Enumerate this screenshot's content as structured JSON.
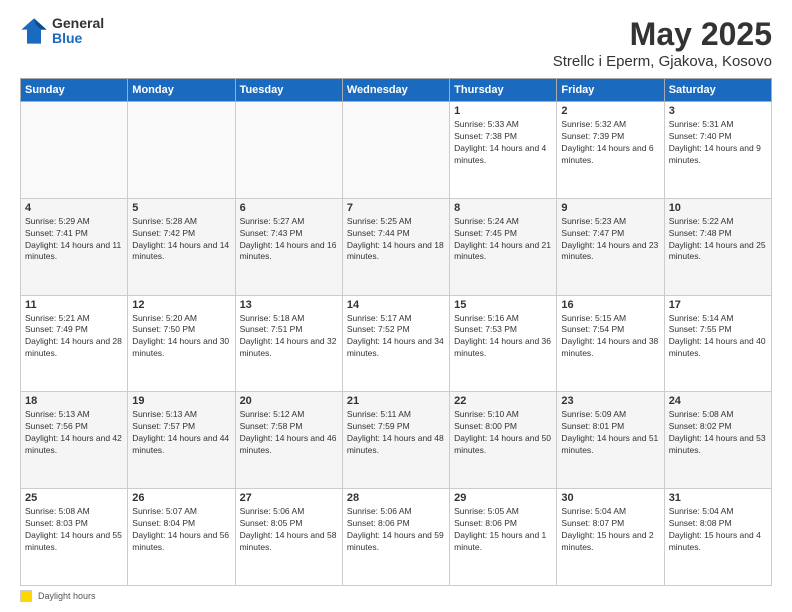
{
  "logo": {
    "general": "General",
    "blue": "Blue"
  },
  "title": "May 2025",
  "subtitle": "Strellc i Eperm, Gjakova, Kosovo",
  "days_of_week": [
    "Sunday",
    "Monday",
    "Tuesday",
    "Wednesday",
    "Thursday",
    "Friday",
    "Saturday"
  ],
  "legend_label": "Daylight hours",
  "weeks": [
    [
      {
        "day": "",
        "empty": true
      },
      {
        "day": "",
        "empty": true
      },
      {
        "day": "",
        "empty": true
      },
      {
        "day": "",
        "empty": true
      },
      {
        "day": "1",
        "sunrise": "Sunrise: 5:33 AM",
        "sunset": "Sunset: 7:38 PM",
        "daylight": "Daylight: 14 hours and 4 minutes."
      },
      {
        "day": "2",
        "sunrise": "Sunrise: 5:32 AM",
        "sunset": "Sunset: 7:39 PM",
        "daylight": "Daylight: 14 hours and 6 minutes."
      },
      {
        "day": "3",
        "sunrise": "Sunrise: 5:31 AM",
        "sunset": "Sunset: 7:40 PM",
        "daylight": "Daylight: 14 hours and 9 minutes."
      }
    ],
    [
      {
        "day": "4",
        "sunrise": "Sunrise: 5:29 AM",
        "sunset": "Sunset: 7:41 PM",
        "daylight": "Daylight: 14 hours and 11 minutes."
      },
      {
        "day": "5",
        "sunrise": "Sunrise: 5:28 AM",
        "sunset": "Sunset: 7:42 PM",
        "daylight": "Daylight: 14 hours and 14 minutes."
      },
      {
        "day": "6",
        "sunrise": "Sunrise: 5:27 AM",
        "sunset": "Sunset: 7:43 PM",
        "daylight": "Daylight: 14 hours and 16 minutes."
      },
      {
        "day": "7",
        "sunrise": "Sunrise: 5:25 AM",
        "sunset": "Sunset: 7:44 PM",
        "daylight": "Daylight: 14 hours and 18 minutes."
      },
      {
        "day": "8",
        "sunrise": "Sunrise: 5:24 AM",
        "sunset": "Sunset: 7:45 PM",
        "daylight": "Daylight: 14 hours and 21 minutes."
      },
      {
        "day": "9",
        "sunrise": "Sunrise: 5:23 AM",
        "sunset": "Sunset: 7:47 PM",
        "daylight": "Daylight: 14 hours and 23 minutes."
      },
      {
        "day": "10",
        "sunrise": "Sunrise: 5:22 AM",
        "sunset": "Sunset: 7:48 PM",
        "daylight": "Daylight: 14 hours and 25 minutes."
      }
    ],
    [
      {
        "day": "11",
        "sunrise": "Sunrise: 5:21 AM",
        "sunset": "Sunset: 7:49 PM",
        "daylight": "Daylight: 14 hours and 28 minutes."
      },
      {
        "day": "12",
        "sunrise": "Sunrise: 5:20 AM",
        "sunset": "Sunset: 7:50 PM",
        "daylight": "Daylight: 14 hours and 30 minutes."
      },
      {
        "day": "13",
        "sunrise": "Sunrise: 5:18 AM",
        "sunset": "Sunset: 7:51 PM",
        "daylight": "Daylight: 14 hours and 32 minutes."
      },
      {
        "day": "14",
        "sunrise": "Sunrise: 5:17 AM",
        "sunset": "Sunset: 7:52 PM",
        "daylight": "Daylight: 14 hours and 34 minutes."
      },
      {
        "day": "15",
        "sunrise": "Sunrise: 5:16 AM",
        "sunset": "Sunset: 7:53 PM",
        "daylight": "Daylight: 14 hours and 36 minutes."
      },
      {
        "day": "16",
        "sunrise": "Sunrise: 5:15 AM",
        "sunset": "Sunset: 7:54 PM",
        "daylight": "Daylight: 14 hours and 38 minutes."
      },
      {
        "day": "17",
        "sunrise": "Sunrise: 5:14 AM",
        "sunset": "Sunset: 7:55 PM",
        "daylight": "Daylight: 14 hours and 40 minutes."
      }
    ],
    [
      {
        "day": "18",
        "sunrise": "Sunrise: 5:13 AM",
        "sunset": "Sunset: 7:56 PM",
        "daylight": "Daylight: 14 hours and 42 minutes."
      },
      {
        "day": "19",
        "sunrise": "Sunrise: 5:13 AM",
        "sunset": "Sunset: 7:57 PM",
        "daylight": "Daylight: 14 hours and 44 minutes."
      },
      {
        "day": "20",
        "sunrise": "Sunrise: 5:12 AM",
        "sunset": "Sunset: 7:58 PM",
        "daylight": "Daylight: 14 hours and 46 minutes."
      },
      {
        "day": "21",
        "sunrise": "Sunrise: 5:11 AM",
        "sunset": "Sunset: 7:59 PM",
        "daylight": "Daylight: 14 hours and 48 minutes."
      },
      {
        "day": "22",
        "sunrise": "Sunrise: 5:10 AM",
        "sunset": "Sunset: 8:00 PM",
        "daylight": "Daylight: 14 hours and 50 minutes."
      },
      {
        "day": "23",
        "sunrise": "Sunrise: 5:09 AM",
        "sunset": "Sunset: 8:01 PM",
        "daylight": "Daylight: 14 hours and 51 minutes."
      },
      {
        "day": "24",
        "sunrise": "Sunrise: 5:08 AM",
        "sunset": "Sunset: 8:02 PM",
        "daylight": "Daylight: 14 hours and 53 minutes."
      }
    ],
    [
      {
        "day": "25",
        "sunrise": "Sunrise: 5:08 AM",
        "sunset": "Sunset: 8:03 PM",
        "daylight": "Daylight: 14 hours and 55 minutes."
      },
      {
        "day": "26",
        "sunrise": "Sunrise: 5:07 AM",
        "sunset": "Sunset: 8:04 PM",
        "daylight": "Daylight: 14 hours and 56 minutes."
      },
      {
        "day": "27",
        "sunrise": "Sunrise: 5:06 AM",
        "sunset": "Sunset: 8:05 PM",
        "daylight": "Daylight: 14 hours and 58 minutes."
      },
      {
        "day": "28",
        "sunrise": "Sunrise: 5:06 AM",
        "sunset": "Sunset: 8:06 PM",
        "daylight": "Daylight: 14 hours and 59 minutes."
      },
      {
        "day": "29",
        "sunrise": "Sunrise: 5:05 AM",
        "sunset": "Sunset: 8:06 PM",
        "daylight": "Daylight: 15 hours and 1 minute."
      },
      {
        "day": "30",
        "sunrise": "Sunrise: 5:04 AM",
        "sunset": "Sunset: 8:07 PM",
        "daylight": "Daylight: 15 hours and 2 minutes."
      },
      {
        "day": "31",
        "sunrise": "Sunrise: 5:04 AM",
        "sunset": "Sunset: 8:08 PM",
        "daylight": "Daylight: 15 hours and 4 minutes."
      }
    ]
  ]
}
